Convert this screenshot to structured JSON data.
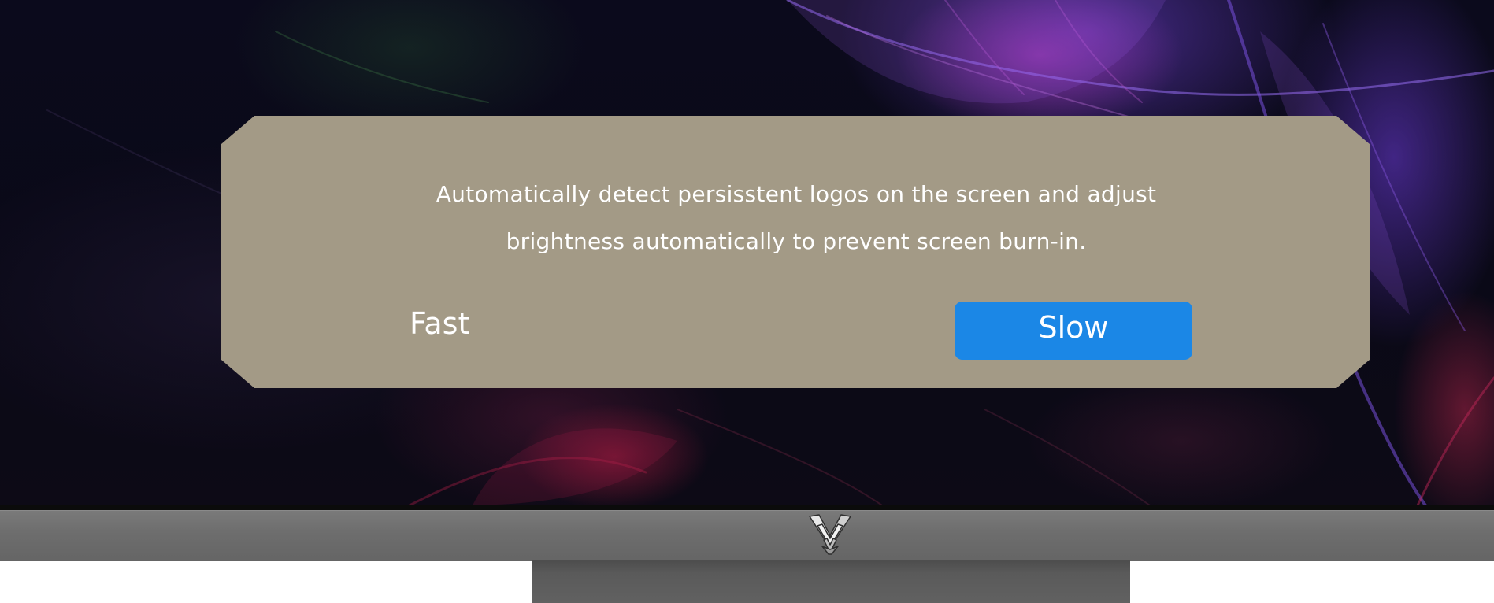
{
  "osd": {
    "message_line_1": "Automatically detect persisstent logos on the screen and adjust",
    "message_line_2": "brightness automatically to prevent screen burn-in.",
    "options": [
      {
        "label": "Fast",
        "selected": false
      },
      {
        "label": "Slow",
        "selected": true
      }
    ]
  },
  "colors": {
    "panel_background": "#a39a86",
    "selected_option": "#1b87e6",
    "text": "#ffffff",
    "bezel": "#6e6e6e"
  },
  "monitor": {
    "logo_icon": "monitor-brand-logo-icon",
    "wallpaper": "dark-leaves-wallpaper"
  }
}
